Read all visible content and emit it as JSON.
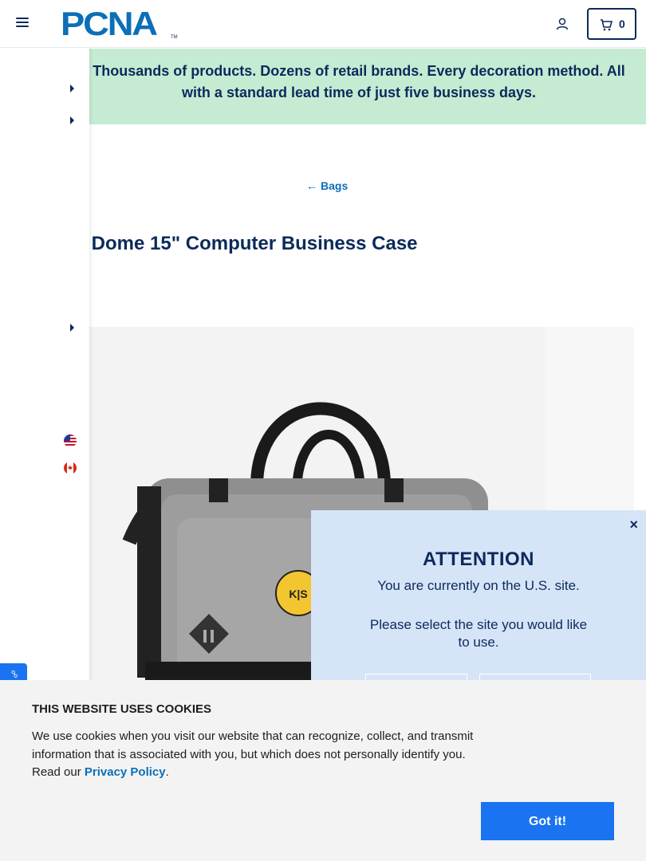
{
  "header": {
    "logo_text": "PCNA",
    "logo_tm": "TM",
    "cart_count": "0",
    "icons": {
      "menu": "hamburger-icon",
      "account": "user-icon",
      "cart": "cart-icon"
    }
  },
  "banner": {
    "text": "Thousands of products. Dozens of retail brands. Every decoration method. All with a standard lead time of just five business days."
  },
  "breadcrumb": {
    "back_label": "Bags",
    "arrow": "←"
  },
  "product": {
    "title": "Dome 15\" Computer Business Case",
    "title_prefix_visible": "-"
  },
  "attention_modal": {
    "close": "×",
    "title": "ATTENTION",
    "line1": "You are currently on the U.S. site.",
    "line2": "Please select the site you would like to use."
  },
  "cookie_banner": {
    "title": "THIS WEBSITE USES COOKIES",
    "body": "We use cookies when you visit our website that can recognize, collect, and transmit information that is associated with you, but which does not personally identify you. Read our ",
    "link": "Privacy Policy",
    "period": ".",
    "button": "Got it!"
  },
  "colors": {
    "brand_blue": "#0c6fb7",
    "navy": "#0b2a5b",
    "banner_green": "#c6ebd3",
    "modal_blue": "#d6e4f7",
    "cta_blue": "#1a73f0"
  }
}
